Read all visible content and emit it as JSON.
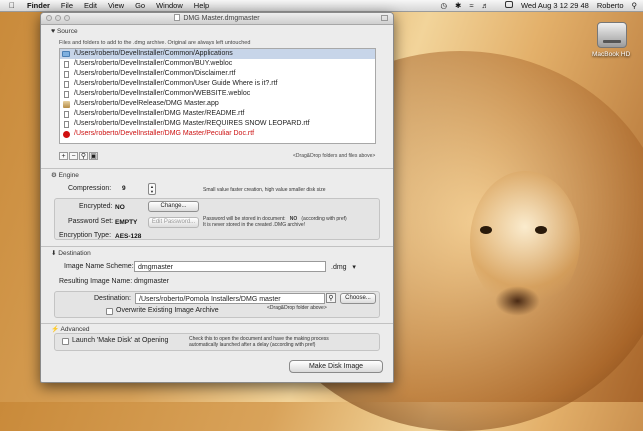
{
  "menubar": {
    "app": "Finder",
    "items": [
      "File",
      "Edit",
      "View",
      "Go",
      "Window",
      "Help"
    ],
    "clock": "Wed Aug 3  12 29 48",
    "user": "Roberto"
  },
  "desktop": {
    "drive_label": "MacBook HD"
  },
  "window": {
    "title": "DMG Master.dmgmaster"
  },
  "source": {
    "heading": "Source",
    "description": "Files and folders to add to the .dmg archive. Original are always left untouched",
    "files": [
      {
        "path": "/Users/roberto/DevelInstaller/Common/Applications",
        "kind": "folder",
        "selected": true,
        "error": false
      },
      {
        "path": "/Users/roberto/DevelInstaller/Common/BUY.webloc",
        "kind": "page",
        "selected": false,
        "error": false
      },
      {
        "path": "/Users/roberto/DevelInstaller/Common/Disclaimer.rtf",
        "kind": "page",
        "selected": false,
        "error": false
      },
      {
        "path": "/Users/roberto/DevelInstaller/Common/User Guide Where is it?.rtf",
        "kind": "page",
        "selected": false,
        "error": false
      },
      {
        "path": "/Users/roberto/DevelInstaller/Common/WEBSITE.webloc",
        "kind": "page",
        "selected": false,
        "error": false
      },
      {
        "path": "/Users/roberto/DevelRelease/DMG Master.app",
        "kind": "app",
        "selected": false,
        "error": false
      },
      {
        "path": "/Users/roberto/DevelInstaller/DMG Master/README.rtf",
        "kind": "page",
        "selected": false,
        "error": false
      },
      {
        "path": "/Users/roberto/DevelInstaller/DMG Master/REQUIRES SNOW LEOPARD.rtf",
        "kind": "page",
        "selected": false,
        "error": false
      },
      {
        "path": "/Users/roberto/DevelInstaller/DMG Master/Peculiar Doc.rtf",
        "kind": "error",
        "selected": false,
        "error": true
      }
    ],
    "list_buttons": [
      "+",
      "−",
      "⚲",
      "▣"
    ],
    "drag_note": "<Drag&Drop folders and files above>"
  },
  "engine": {
    "heading": "Engine",
    "compression_label": "Compression:",
    "compression_value": "9",
    "compression_note": "Small value faster creation, high value smaller disk size",
    "encrypted_label": "Encrypted:",
    "encrypted_value": "NO",
    "change_button": "Change...",
    "password_label": "Password Set:",
    "password_value": "EMPTY",
    "edit_password_button": "Edit Password...",
    "password_note_1": "Password  will be stored in document:",
    "password_note_value": "NO",
    "password_note_2": "(according with pref)",
    "password_note_3": "It is never stored in the created .DMG archive!",
    "encryption_type_label": "Encryption Type:",
    "encryption_type_value": "AES-128"
  },
  "destination": {
    "heading": "Destination",
    "image_name_label": "Image Name Scheme:",
    "image_name_value": "dmgmaster",
    "extension": ".dmg",
    "resulting_label": "Resulting Image Name:",
    "resulting_value": "dmgmaster",
    "destination_label": "Destination:",
    "destination_value": "/Users/roberto/Pomola Installers/DMG master",
    "choose_button": "Choose...",
    "drag_note": "<Drag&Drop folder above>",
    "overwrite_label": "Overwrite Existing Image Archive"
  },
  "advanced": {
    "heading": "Advanced",
    "launch_label": "Launch 'Make Disk' at Opening",
    "launch_note_1": "Check this to open the document and have the making process",
    "launch_note_2": "automatically launched after a delay (according with pref)"
  },
  "make_button": "Make Disk Image"
}
